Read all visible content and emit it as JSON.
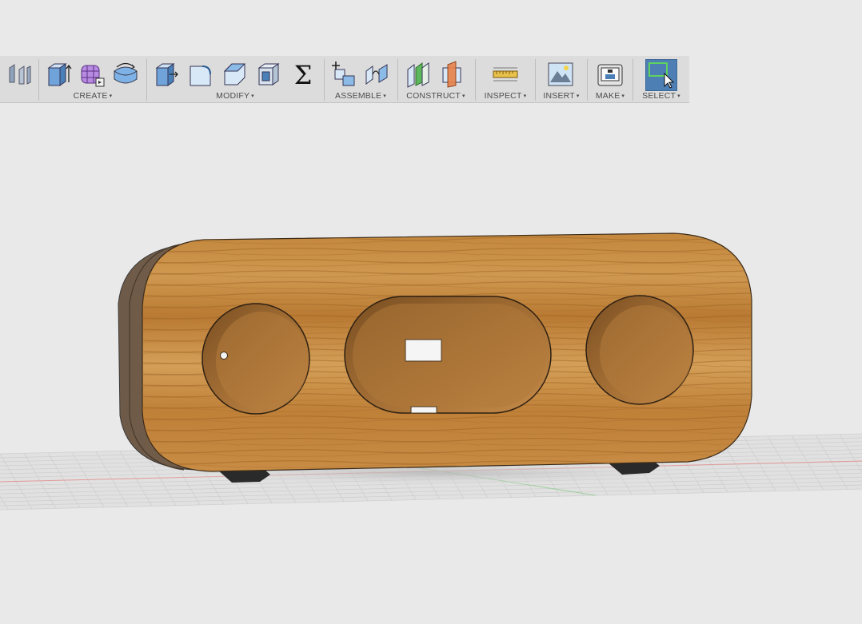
{
  "toolbar": {
    "groups": {
      "create": {
        "label": "CREATE"
      },
      "modify": {
        "label": "MODIFY"
      },
      "assemble": {
        "label": "ASSEMBLE"
      },
      "construct": {
        "label": "CONSTRUCT"
      },
      "inspect": {
        "label": "INSPECT"
      },
      "insert": {
        "label": "INSERT"
      },
      "make": {
        "label": "MAKE"
      },
      "select": {
        "label": "SELECT"
      }
    },
    "dropdown_glyph": "▾",
    "sum_glyph": "Σ"
  },
  "icons": [
    "workflow-switch-icon",
    "extrude-icon",
    "sculpt-form-icon",
    "patch-surface-icon",
    "press-pull-icon",
    "fillet-icon",
    "chamfer-icon",
    "shell-icon",
    "parameters-sum-icon",
    "new-component-icon",
    "joint-icon",
    "offset-plane-icon",
    "midplane-icon",
    "measure-icon",
    "insert-image-icon",
    "3d-print-icon",
    "select-window-icon"
  ],
  "scene": {
    "model": "wooden-speaker-enclosure",
    "colors": {
      "wood_light": "#c99447",
      "wood_dark": "#8a5a22",
      "background": "#e9e9e9",
      "grid": "#c8c8c8",
      "x_axis": "#e08080",
      "y_axis": "#80c080"
    }
  }
}
